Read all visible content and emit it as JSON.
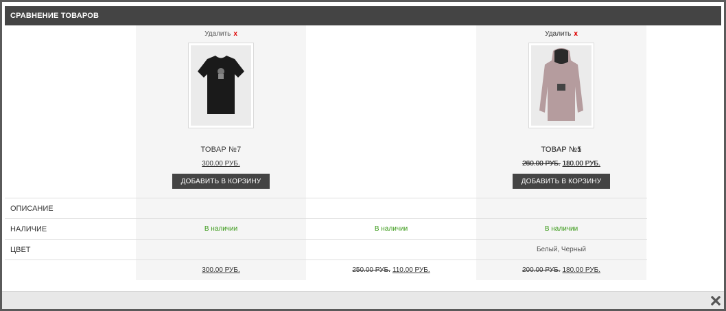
{
  "header": {
    "title": "СРАВНЕНИЕ ТОВАРОВ"
  },
  "remove_label": "Удалить",
  "remove_mark": "x",
  "cart_label": "ДОБАВИТЬ В КОРЗИНУ",
  "attributes": {
    "description_label": "ОПИСАНИЕ",
    "availability_label": "НАЛИЧИЕ",
    "color_label": "ЦВЕТ"
  },
  "products": [
    {
      "name": "ТОВАР №7",
      "image_icon": "black-tshirt",
      "old_price": "",
      "price": "300.00 РУБ.",
      "availability": "В наличии",
      "color": ""
    },
    {
      "name": "ТОВАР №5",
      "image_icon": "pink-hoodie",
      "old_price": "250.00 РУБ.",
      "price": "110.00 РУБ.",
      "availability": "В наличии",
      "color": ""
    },
    {
      "name": "ТОВАР №1",
      "image_icon": "grey-hoodie",
      "old_price": "200.00 РУБ.",
      "price": "180.00 РУБ.",
      "availability": "В наличии",
      "color": "Белый, Черный"
    }
  ],
  "colors": {
    "header_bg": "#444444",
    "button_bg": "#444444",
    "available": "#3a9a18",
    "remove_x": "#e00000",
    "column_shade": "#f5f5f5"
  }
}
